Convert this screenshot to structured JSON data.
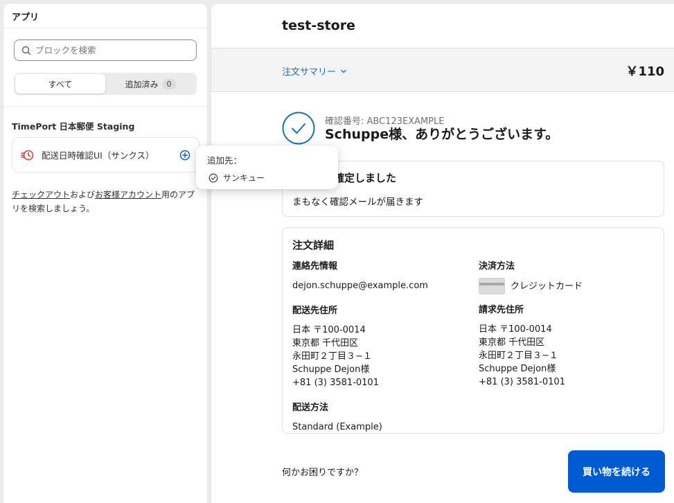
{
  "left_panel": {
    "title": "アプリ",
    "search": {
      "placeholder": "ブロックを検索",
      "value": ""
    },
    "segments": {
      "all_label": "すべて",
      "added_label": "追加済み",
      "added_count": "0"
    },
    "app_name": "TimePort 日本郵便 Staging",
    "block": {
      "label": "配送日時確認UI（サンクス）",
      "icon": "timeport-logo-icon",
      "action_icon": "plus-circle-icon"
    },
    "help": {
      "link1": "チェックアウト",
      "text1": "および",
      "link2": "お客様アカウント",
      "text2": "用のアプリを検索しましょう。"
    }
  },
  "popover": {
    "title": "追加先：",
    "item_label": "サンキュー",
    "item_icon": "check-circle-icon"
  },
  "preview": {
    "store_name": "test-store",
    "summary_label": "注文サマリー",
    "total": "￥110",
    "confirmation_number": "確認番号: ABC123EXAMPLE",
    "thanks": "Schuppe様、ありがとうございます。",
    "confirmed_title": "ご注文を確定しました",
    "confirmed_sub": "まもなく確認メールが届きます",
    "details_title": "注文詳細",
    "contact_heading": "連絡先情報",
    "contact_email": "dejon.schuppe@example.com",
    "shipping_address_heading": "配送先住所",
    "shipping_address": [
      "日本 〒100-0014",
      "東京都 千代田区",
      "永田町２丁目３−１",
      "Schuppe Dejon様",
      "+81 (3) 3581-0101"
    ],
    "shipping_method_heading": "配送方法",
    "shipping_method": "Standard (Example)",
    "payment_heading": "決済方法",
    "payment_method": "クレジットカード",
    "billing_heading": "請求先住所",
    "billing_address": [
      "日本 〒100-0014",
      "東京都 千代田区",
      "永田町２丁目３−１",
      "Schuppe Dejon様",
      "+81 (3) 3581-0101"
    ],
    "help_question": "何かお困りですか？",
    "continue_button": "買い物を続ける"
  },
  "colors": {
    "accent": "#005bd3",
    "link": "#1773b0",
    "confirmation": "#1773b0"
  }
}
